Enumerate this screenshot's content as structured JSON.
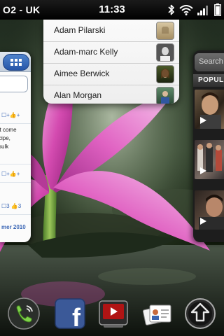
{
  "status_bar": {
    "carrier": "O2 - UK",
    "time": "11:33",
    "icons": [
      "bluetooth-icon",
      "wifi-icon",
      "signal-icon",
      "battery-icon"
    ]
  },
  "contacts_menu": {
    "items": [
      {
        "name": "Adam Pilarski",
        "avatar_icon": "contact-photo-placeholder"
      },
      {
        "name": "Adam-marc Kelly",
        "avatar_icon": "contact-photo"
      },
      {
        "name": "Aimee Berwick",
        "avatar_icon": "contact-photo"
      },
      {
        "name": "Alan Morgan",
        "avatar_icon": "contact-photo"
      }
    ]
  },
  "left_card": {
    "top_button_icon": "grid-icon",
    "feed": [
      {
        "lines": [],
        "actions": "☐+👍+"
      },
      {
        "lines": [
          "'t come",
          "cipe,",
          "sulk"
        ],
        "actions": ""
      },
      {
        "lines": [],
        "actions": "☐+👍+"
      },
      {
        "lines": [],
        "actions": "☐3 👍3"
      }
    ],
    "date_text": "mer 2010"
  },
  "right_card": {
    "search_placeholder": "Search",
    "section_header": "POPULA",
    "thumbnails": [
      "video-thumbnail",
      "video-thumbnail",
      "video-thumbnail"
    ]
  },
  "dock": {
    "apps": [
      {
        "name": "phone",
        "icon": "phone-icon"
      },
      {
        "name": "facebook",
        "icon": "facebook-icon",
        "letter": "f"
      },
      {
        "name": "youtube",
        "icon": "video-player-icon"
      },
      {
        "name": "contacts",
        "icon": "contacts-icon"
      },
      {
        "name": "launcher",
        "icon": "launcher-arrow-icon"
      }
    ]
  },
  "colors": {
    "status_bar": "#000000",
    "facebook_blue": "#3b5998",
    "flower_pink": "#d94fb0",
    "popup_bg": "#f4f4f4",
    "link_blue": "#3b66b5"
  }
}
